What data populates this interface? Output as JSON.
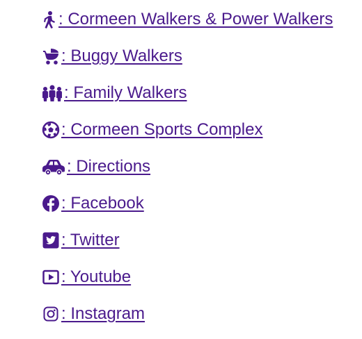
{
  "links": [
    {
      "icon": "walking-person-icon",
      "label": ": Cormeen Walkers & Power Walkers"
    },
    {
      "icon": "baby-carriage-icon",
      "label": ": Buggy Walkers"
    },
    {
      "icon": "family-group-icon",
      "label": ": Family Walkers"
    },
    {
      "icon": "soccer-ball-icon",
      "label": ": Cormeen Sports Complex"
    },
    {
      "icon": "car-icon",
      "label": ": Directions"
    },
    {
      "icon": "facebook-icon",
      "label": ": Facebook"
    },
    {
      "icon": "twitter-icon",
      "label": ": Twitter"
    },
    {
      "icon": "youtube-icon",
      "label": ": Youtube"
    },
    {
      "icon": "instagram-icon",
      "label": ": Instagram"
    }
  ],
  "colors": {
    "link": "#4a1a8c",
    "background": "#ffffff"
  }
}
